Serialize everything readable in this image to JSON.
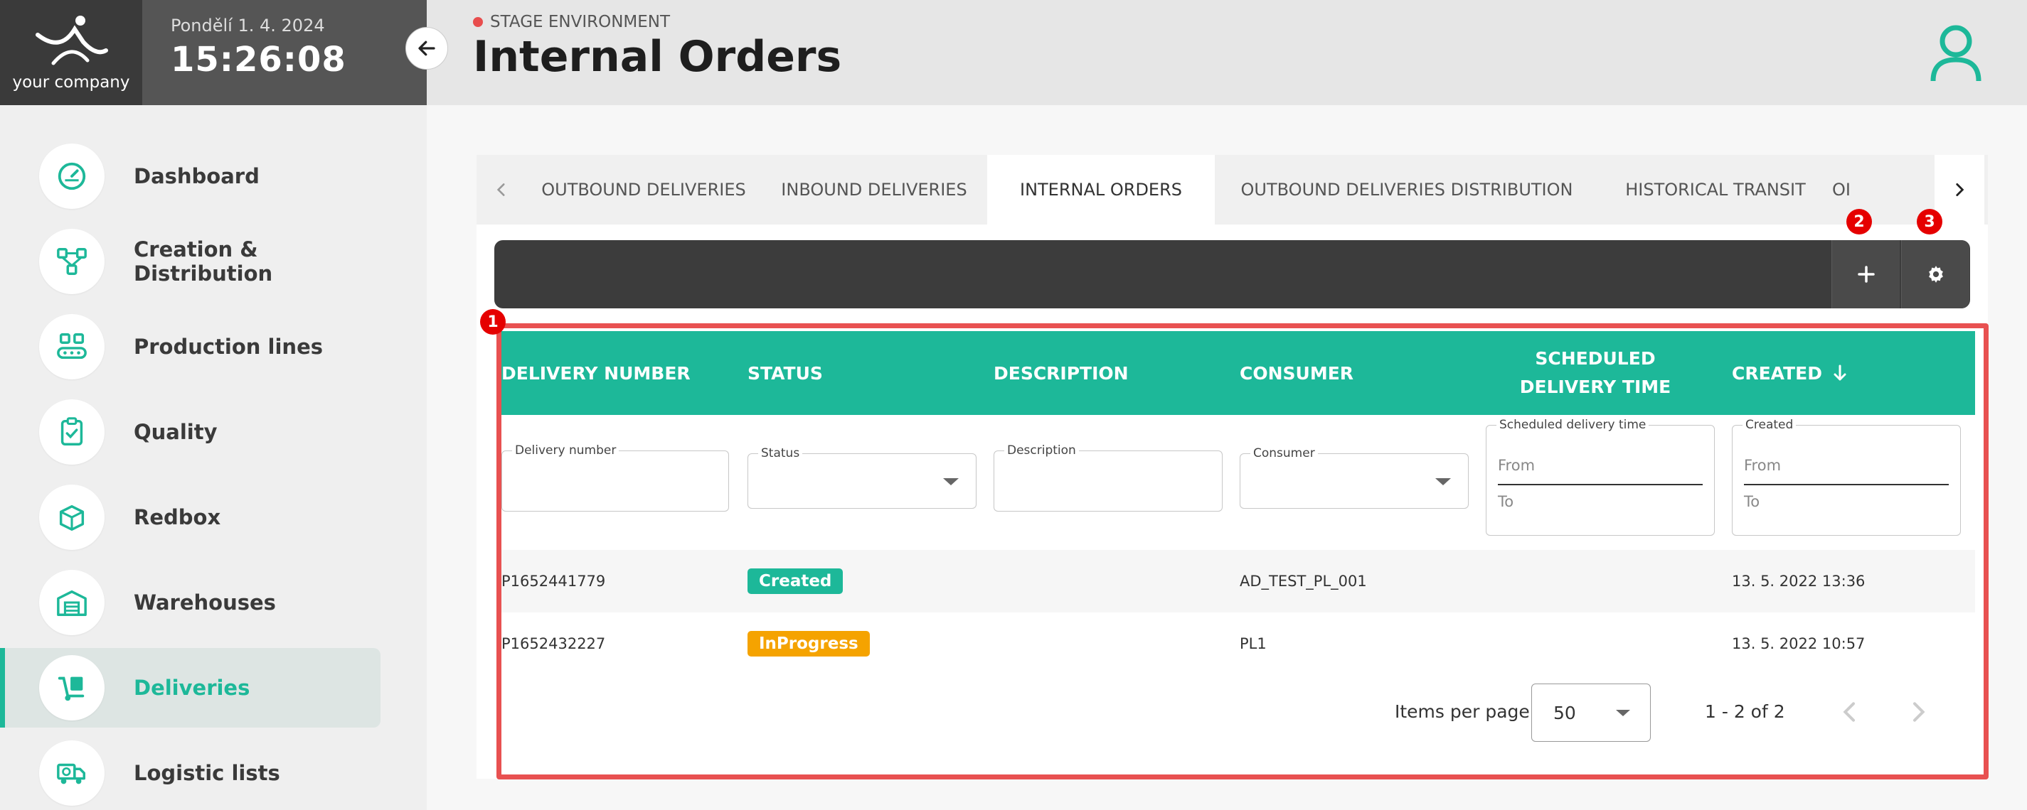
{
  "brand": {
    "name": "your company",
    "logo_icon": "company-logo-icon"
  },
  "clock": {
    "date": "Pondělí 1. 4. 2024",
    "time": "15:26:08"
  },
  "header": {
    "environment": "STAGE ENVIRONMENT",
    "title": "Internal Orders",
    "user_icon": "user-icon"
  },
  "sidebar": {
    "items": [
      {
        "label": "Dashboard",
        "icon": "gauge-icon",
        "active": false
      },
      {
        "label": "Creation & Distribution",
        "icon": "network-icon",
        "active": false
      },
      {
        "label": "Production lines",
        "icon": "conveyor-icon",
        "active": false
      },
      {
        "label": "Quality",
        "icon": "clipboard-check-icon",
        "active": false
      },
      {
        "label": "Redbox",
        "icon": "box-icon",
        "active": false
      },
      {
        "label": "Warehouses",
        "icon": "warehouse-icon",
        "active": false
      },
      {
        "label": "Deliveries",
        "icon": "hand-truck-icon",
        "active": true
      },
      {
        "label": "Logistic lists",
        "icon": "delivery-truck-icon",
        "active": false
      }
    ]
  },
  "tabs": [
    {
      "label": "OUTBOUND DELIVERIES",
      "active": false
    },
    {
      "label": "INBOUND DELIVERIES",
      "active": false
    },
    {
      "label": "INTERNAL ORDERS",
      "active": true
    },
    {
      "label": "OUTBOUND DELIVERIES DISTRIBUTION",
      "active": false
    },
    {
      "label": "HISTORICAL TRANSIT",
      "active": false
    },
    {
      "label": "OI",
      "active": false
    }
  ],
  "toolbar": {
    "add_icon": "plus-icon",
    "settings_icon": "gear-icon"
  },
  "table": {
    "columns": [
      "DELIVERY NUMBER",
      "STATUS",
      "DESCRIPTION",
      "CONSUMER",
      "SCHEDULED DELIVERY TIME",
      "CREATED"
    ],
    "sorted_column": "CREATED",
    "sort_direction": "descending",
    "filters": {
      "delivery_number": "Delivery number",
      "status": "Status",
      "description": "Description",
      "consumer": "Consumer",
      "scheduled": {
        "label": "Scheduled delivery time",
        "from": "From",
        "to": "To"
      },
      "created": {
        "label": "Created",
        "from": "From",
        "to": "To"
      }
    },
    "rows": [
      {
        "delivery_number": "P1652441779",
        "status": "Created",
        "status_color": "#1db899",
        "description": "",
        "consumer": "AD_TEST_PL_001",
        "scheduled": "",
        "created": "13. 5. 2022 13:36"
      },
      {
        "delivery_number": "P1652432227",
        "status": "InProgress",
        "status_color": "#f5a300",
        "description": "",
        "consumer": "PL1",
        "scheduled": "",
        "created": "13. 5. 2022 10:57"
      }
    ]
  },
  "pagination": {
    "items_per_page_label": "Items per page",
    "items_per_page": "50",
    "range": "1 - 2 of 2"
  },
  "markers": [
    "1",
    "2",
    "3"
  ],
  "colors": {
    "accent": "#1db899",
    "highlight": "#e85151",
    "marker": "#e50000",
    "inprogress": "#f5a300"
  }
}
